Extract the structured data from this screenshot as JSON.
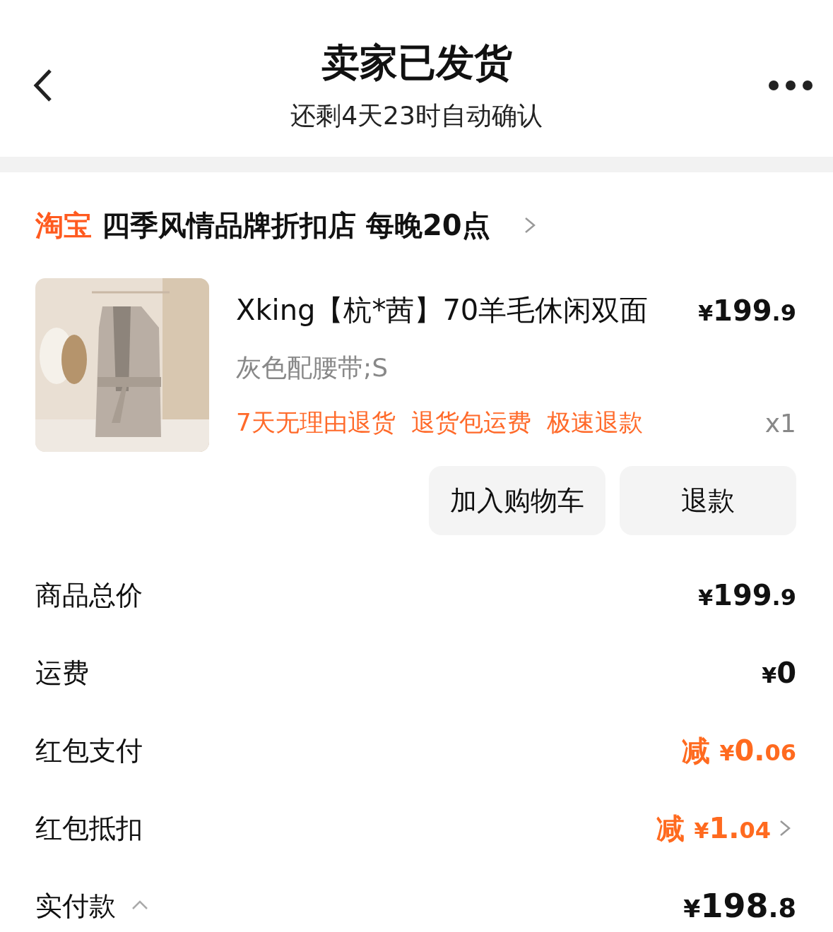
{
  "header": {
    "title": "卖家已发货",
    "subtitle": "还剩4天23时自动确认"
  },
  "store": {
    "badge": "淘宝",
    "name": "四季风情品牌折扣店 每晚20点"
  },
  "product": {
    "image": {
      "kind": "picture"
    },
    "title": "Xking【杭*茜】70羊毛休闲双面",
    "price": {
      "currency": "¥",
      "amount": "199",
      "cents": ".9"
    },
    "variant": "灰色配腰带;S",
    "tags": [
      "7天无理由退货",
      "退货包运费",
      "极速退款"
    ],
    "quantity": "x1",
    "actions": [
      "加入购物车",
      "退款"
    ]
  },
  "summary": [
    {
      "label": "商品总价",
      "highlight": false,
      "price": {
        "currency": "¥",
        "amount": "199",
        "cents": ".9"
      },
      "link": false
    },
    {
      "label": "运费",
      "highlight": false,
      "price": {
        "currency": "¥",
        "amount": "0"
      },
      "link": false
    },
    {
      "label": "红包支付",
      "highlight": true,
      "prefix": "减",
      "price": {
        "currency": "¥",
        "amount": "0.",
        "cents": "06"
      },
      "link": false
    },
    {
      "label": "红包抵扣",
      "highlight": true,
      "prefix": "减",
      "price": {
        "currency": "¥",
        "amount": "1.",
        "cents": "04"
      },
      "link": true
    },
    {
      "label": "实付款",
      "highlight": false,
      "price": {
        "currency": "¥",
        "amount": "198",
        "cents": ".8"
      },
      "link": false,
      "expanded": true,
      "big": true
    }
  ]
}
